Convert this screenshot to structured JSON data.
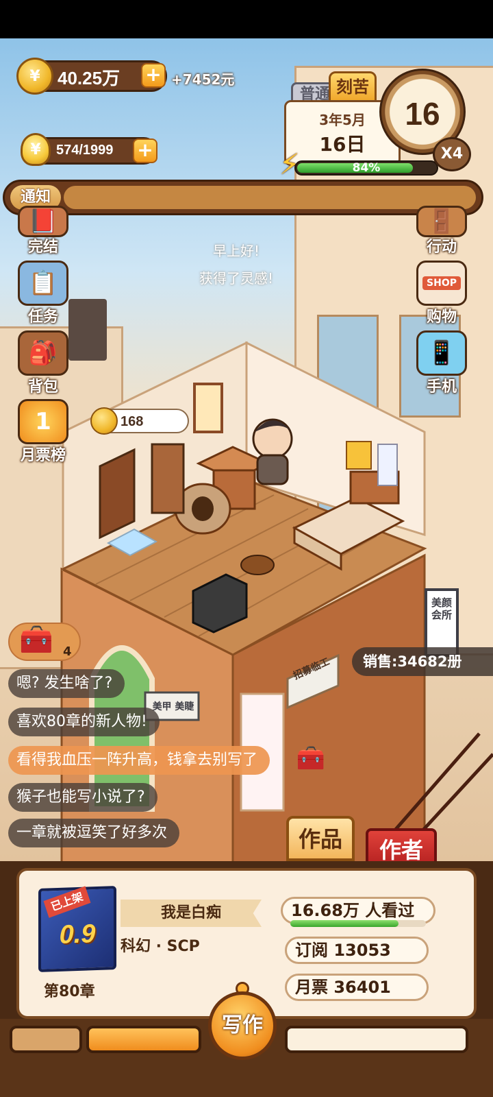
{
  "hud": {
    "coins": "40.25万",
    "income": "+7452元",
    "inspiration": "574/1999",
    "plus_icon": "+",
    "coin_icon": "coin-icon",
    "bulb_icon": "lightbulb-icon"
  },
  "calendar": {
    "mode_normal": "普通",
    "mode_hard": "刻苦",
    "year_month": "3年5月",
    "day": "16日",
    "clock_day": "16",
    "speed": "X4",
    "energy_percent": 84,
    "energy_label": "84%"
  },
  "notice": {
    "label": "通知"
  },
  "menu": {
    "left": [
      {
        "label": "完结",
        "icon": "book-icon"
      },
      {
        "label": "任务",
        "icon": "checklist-icon"
      },
      {
        "label": "背包",
        "icon": "backpack-icon"
      },
      {
        "label": "月票榜",
        "icon": "ticket-coin-icon",
        "glyph": "1"
      }
    ],
    "right": [
      {
        "label": "行动",
        "icon": "door-icon"
      },
      {
        "label": "购物",
        "icon": "shop-icon",
        "badge": "SHOP"
      },
      {
        "label": "手机",
        "icon": "phone-icon"
      }
    ]
  },
  "greeting": {
    "line1": "早上好!",
    "line2": "获得了灵感!"
  },
  "room": {
    "coin_bubble": "168",
    "sales": "销售:34682册",
    "signs": {
      "hire": "招募临工",
      "nail": "美甲 美睫",
      "salon": "美颜会所"
    }
  },
  "chest": {
    "count": "4"
  },
  "comments": [
    {
      "text": "嗯? 发生啥了?",
      "highlight": false
    },
    {
      "text": "喜欢80章的新人物!",
      "highlight": false
    },
    {
      "text": "看得我血压一阵升高，钱拿去别写了",
      "highlight": true
    },
    {
      "text": "猴子也能写小说了?",
      "highlight": false
    },
    {
      "text": "一章就被逗笑了好多次",
      "highlight": false
    }
  ],
  "tabs": {
    "works": "作品",
    "author": "作者"
  },
  "book": {
    "status": "已上架",
    "score": "0.9",
    "chapter": "第80章",
    "title": "我是白痴",
    "genre": "科幻 · SCP",
    "views": "16.68万 人看过",
    "views_fill": 0.8,
    "subscriptions": "订阅 13053",
    "monthly_tickets": "月票 36401"
  },
  "actions": {
    "write": "写作"
  },
  "colors": {
    "brown_dark": "#4a2a12",
    "gold": "#f0b72a",
    "accent_orange": "#f08d1e",
    "author_red": "#c4282a",
    "energy_green": "#2e9d2b"
  }
}
